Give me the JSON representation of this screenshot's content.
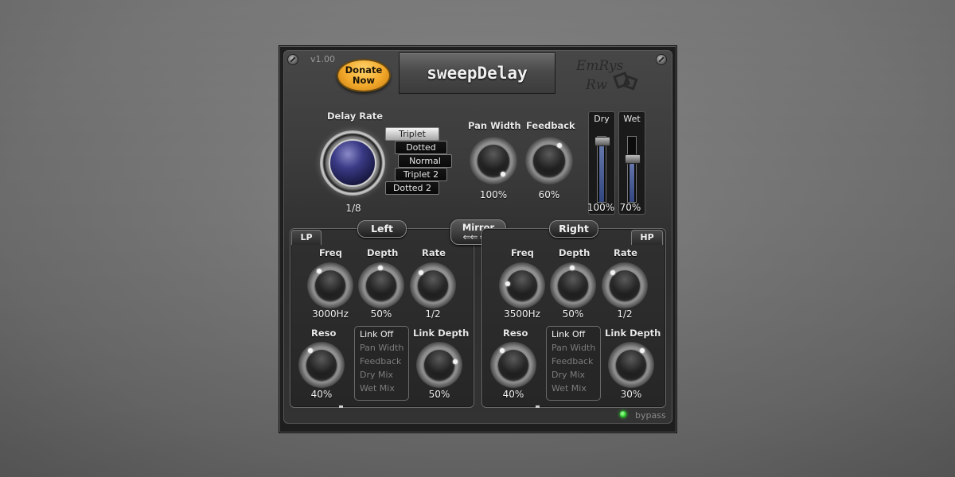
{
  "header": {
    "version": "v1.00",
    "donate_label_1": "Donate",
    "donate_label_2": "Now",
    "title": "sweepDelay",
    "logo_line1": "EmRys",
    "logo_line2": "Rw"
  },
  "delay": {
    "rate_label": "Delay Rate",
    "rate_value": "1/8",
    "options": [
      "Triplet",
      "Dotted",
      "Normal",
      "Triplet 2",
      "Dotted 2"
    ],
    "selected_index": 0
  },
  "pan": {
    "label": "Pan Width",
    "value": "100%",
    "level": 1.0
  },
  "feedback": {
    "label": "Feedback",
    "value": "60%",
    "level": 0.6
  },
  "dry": {
    "label": "Dry",
    "value": "100%",
    "level": 1.0
  },
  "wet": {
    "label": "Wet",
    "value": "70%",
    "level": 0.7
  },
  "mirror": {
    "label": "Mirror",
    "arrows": "⇐⇐ ⇒⇒"
  },
  "left": {
    "title": "Left",
    "filter_tag": "LP",
    "freq": {
      "label": "Freq",
      "value": "3000Hz"
    },
    "depth": {
      "label": "Depth",
      "value": "50%"
    },
    "rate": {
      "label": "Rate",
      "value": "1/2"
    },
    "reso": {
      "label": "Reso",
      "value": "40%"
    },
    "link_depth": {
      "label": "Link Depth",
      "value": "50%"
    },
    "link_options": [
      "Link Off",
      "Pan Width",
      "Feedback",
      "Dry Mix",
      "Wet Mix"
    ]
  },
  "right": {
    "title": "Right",
    "filter_tag": "HP",
    "freq": {
      "label": "Freq",
      "value": "3500Hz"
    },
    "depth": {
      "label": "Depth",
      "value": "50%"
    },
    "rate": {
      "label": "Rate",
      "value": "1/2"
    },
    "reso": {
      "label": "Reso",
      "value": "40%"
    },
    "link_depth": {
      "label": "Link Depth",
      "value": "30%"
    },
    "link_options": [
      "Link Off",
      "Pan Width",
      "Feedback",
      "Dry Mix",
      "Wet Mix"
    ]
  },
  "footer": {
    "bypass": "bypass",
    "led_color": "#2fd52f"
  }
}
